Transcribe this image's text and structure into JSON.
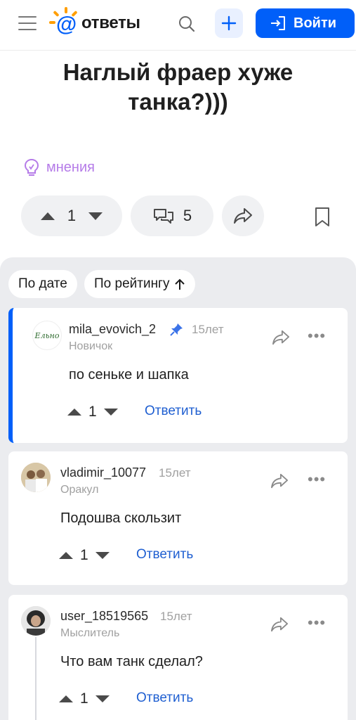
{
  "header": {
    "logo_text": "ответы",
    "login_label": "Войти"
  },
  "question": {
    "title": "Наглый фраер хуже танка?)))",
    "category": "мнения",
    "votes": "1",
    "comments": "5"
  },
  "sort": {
    "by_date": "По дате",
    "by_rating": "По рейтингу"
  },
  "answers": [
    {
      "username": "mila_evovich_2",
      "years": "15лет",
      "rank": "Новичок",
      "text": "по сеньке и шапка",
      "votes": "1",
      "reply": "Ответить",
      "pinned": true,
      "avatar_text": "Ельно"
    },
    {
      "username": "vladimir_10077",
      "years": "15лет",
      "rank": "Оракул",
      "text": "Подошва скользит",
      "votes": "1",
      "reply": "Ответить",
      "pinned": false
    },
    {
      "username": "user_18519565",
      "years": "15лет",
      "rank": "Мыслитель",
      "text": "Что вам танк сделал?",
      "votes": "1",
      "reply": "Ответить",
      "pinned": false
    }
  ],
  "colors": {
    "brand_blue": "#005ff9",
    "logo_orange": "#ff9e00",
    "tag_purple": "#b57be8",
    "reply_blue": "#1f5fd1",
    "answers_bg": "#ebecef"
  },
  "icons": [
    "menu-icon",
    "search-icon",
    "plus-icon",
    "login-icon",
    "lightbulb-icon",
    "upvote-icon",
    "downvote-icon",
    "comments-icon",
    "share-icon",
    "bookmark-icon",
    "arrow-up-icon",
    "pin-icon",
    "more-icon"
  ]
}
